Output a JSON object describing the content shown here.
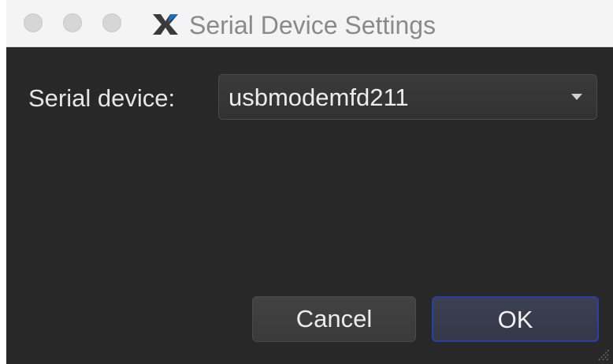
{
  "window": {
    "title": "Serial Device Settings"
  },
  "app": {
    "icon": "x-app-icon"
  },
  "form": {
    "serial_device_label": "Serial device:",
    "serial_device_value": "usbmodemfd211"
  },
  "buttons": {
    "cancel_label": "Cancel",
    "ok_label": "OK"
  },
  "colors": {
    "background": "#282828",
    "titlebar": "#f4f4f4",
    "accent": "#2a3fa8"
  }
}
